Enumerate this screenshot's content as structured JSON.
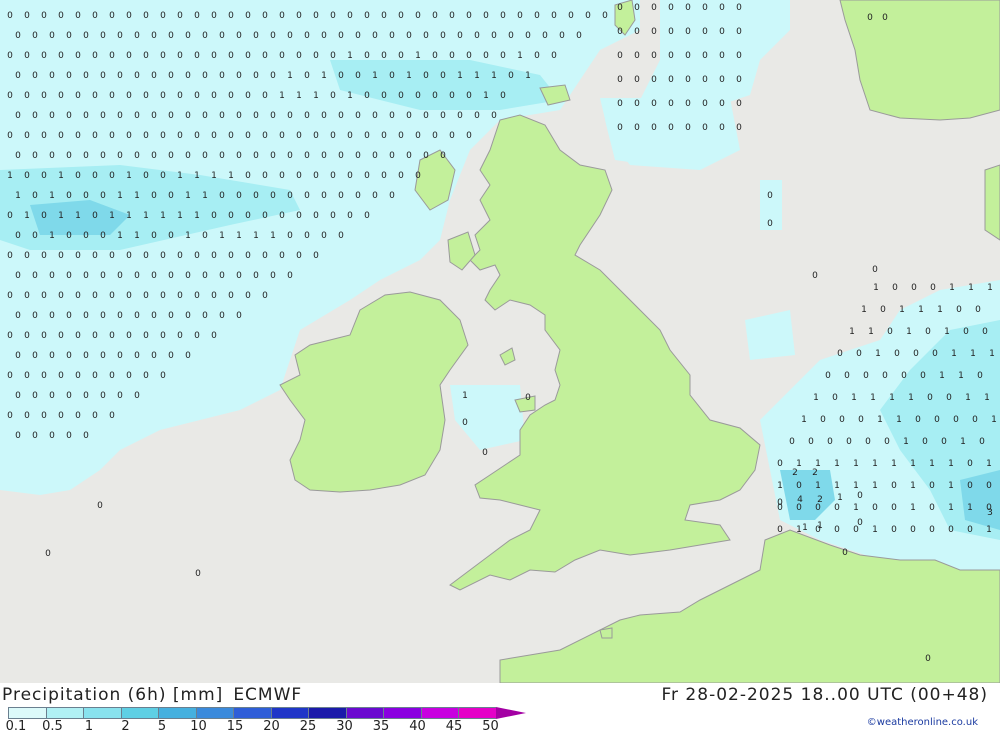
{
  "title": "Precipitation (6h) [mm]",
  "model": "ECMWF",
  "valid_time": "Fr 28-02-2025 18..00 UTC (00+48)",
  "credit": "©weatheronline.co.uk",
  "colors": {
    "sea": "#e9e9e6",
    "land": "#c3f09b",
    "coast": "#9a9a9a",
    "precip_light": "#ccf8fa",
    "precip_mid": "#a7eef3",
    "precip_heavy": "#7fd9ea"
  },
  "legend": {
    "labels": [
      "0.1",
      "0.5",
      "1",
      "2",
      "5",
      "10",
      "15",
      "20",
      "25",
      "30",
      "35",
      "40",
      "45",
      "50"
    ],
    "colors": [
      "#dcfafa",
      "#b0f0f4",
      "#88e2ee",
      "#5ecfe4",
      "#45b0df",
      "#3a8adc",
      "#2e5ed8",
      "#1f36c8",
      "#1a1aaa",
      "#6a0ad0",
      "#8a00e0",
      "#c800e0",
      "#e400c8",
      "#a300a3"
    ]
  },
  "labels": [
    {
      "text": "0",
      "region": "atl"
    },
    {
      "text": "1",
      "region": "atl"
    },
    {
      "text": "2",
      "region": "atl"
    },
    {
      "text": "0",
      "region": "north"
    },
    {
      "text": "1",
      "region": "north"
    },
    {
      "text": "2",
      "region": "north"
    },
    {
      "text": "0",
      "region": "norway"
    },
    {
      "text": "0",
      "region": "channel"
    },
    {
      "text": "1",
      "region": "channel"
    },
    {
      "text": "2",
      "region": "channel"
    },
    {
      "text": "4",
      "region": "channel"
    },
    {
      "text": "0",
      "region": "east"
    },
    {
      "text": "1",
      "region": "east"
    },
    {
      "text": "3",
      "region": "east"
    }
  ]
}
